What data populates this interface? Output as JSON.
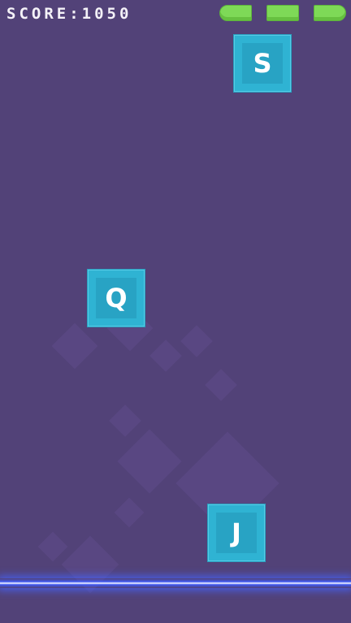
{
  "hud": {
    "score_text": "SCORE:1050",
    "lives_remaining": 3
  },
  "tiles": [
    {
      "letter": "S"
    },
    {
      "letter": "Q"
    },
    {
      "letter": "J"
    }
  ],
  "colors": {
    "background": "#524278",
    "tile": "#2fb3d3",
    "life": "#7ed957",
    "laser": "#3c5aff"
  }
}
